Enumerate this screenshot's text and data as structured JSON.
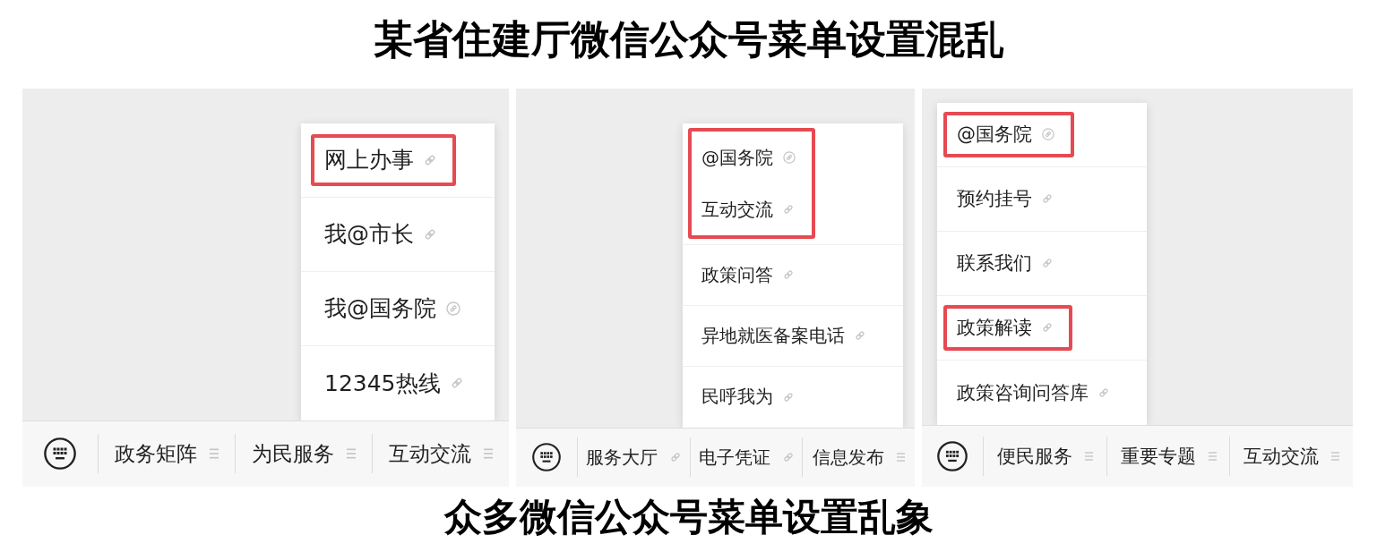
{
  "title": "某省住建厅微信公众号菜单设置混乱",
  "panels": [
    {
      "menu_bar": {
        "tabs": [
          {
            "label": "政务矩阵",
            "kind": "menu"
          },
          {
            "label": "为民服务",
            "kind": "menu"
          },
          {
            "label": "互动交流",
            "kind": "menu",
            "submenu": {
              "items": [
                {
                  "label": "网上办事",
                  "kind": "link",
                  "highlighted": true
                },
                {
                  "label": "我@市长",
                  "kind": "link",
                  "highlighted": false
                },
                {
                  "label": "我@国务院",
                  "kind": "mini_program",
                  "highlighted": false
                },
                {
                  "label": "12345热线",
                  "kind": "link",
                  "highlighted": false
                }
              ]
            }
          }
        ]
      }
    },
    {
      "menu_bar": {
        "tabs": [
          {
            "label": "服务大厅",
            "kind": "link"
          },
          {
            "label": "电子凭证",
            "kind": "link"
          },
          {
            "label": "信息发布",
            "kind": "menu",
            "submenu": {
              "items": [
                {
                  "label": "@国务院",
                  "kind": "mini_program",
                  "highlighted": true
                },
                {
                  "label": "互动交流",
                  "kind": "link",
                  "highlighted": true
                },
                {
                  "label": "政策问答",
                  "kind": "link",
                  "highlighted": false
                },
                {
                  "label": "异地就医备案电话",
                  "kind": "link",
                  "highlighted": false
                },
                {
                  "label": "民呼我为",
                  "kind": "link",
                  "highlighted": false
                }
              ]
            }
          }
        ]
      }
    },
    {
      "menu_bar": {
        "tabs": [
          {
            "label": "便民服务",
            "kind": "menu",
            "submenu": {
              "items": [
                {
                  "label": "@国务院",
                  "kind": "mini_program",
                  "highlighted": true
                },
                {
                  "label": "预约挂号",
                  "kind": "link",
                  "highlighted": false
                },
                {
                  "label": "联系我们",
                  "kind": "link",
                  "highlighted": false
                },
                {
                  "label": "政策解读",
                  "kind": "link",
                  "highlighted": true
                },
                {
                  "label": "政策咨询问答库",
                  "kind": "link",
                  "highlighted": false
                }
              ]
            }
          },
          {
            "label": "重要专题",
            "kind": "menu"
          },
          {
            "label": "互动交流",
            "kind": "menu"
          }
        ]
      }
    }
  ],
  "caption": "众多微信公众号菜单设置乱象"
}
